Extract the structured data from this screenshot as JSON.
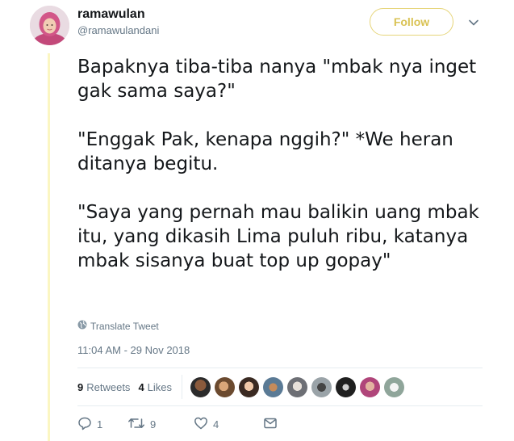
{
  "header": {
    "display_name": "ramawulan",
    "handle": "@ramawulandani",
    "follow_label": "Follow"
  },
  "tweet": {
    "paragraphs": [
      "Bapaknya tiba-tiba nanya \"mbak nya inget gak sama saya?\"",
      "\"Enggak Pak, kenapa nggih?\" *We heran ditanya begitu.",
      "\"Saya yang pernah mau balikin uang mbak itu, yang dikasih Lima puluh ribu, katanya mbak sisanya buat top up gopay\""
    ],
    "translate_label": "Translate Tweet",
    "timestamp": "11:04 AM - 29 Nov 2018"
  },
  "stats": {
    "retweets_count": "9",
    "retweets_label": "Retweets",
    "likes_count": "4",
    "likes_label": "Likes"
  },
  "actions": {
    "reply_count": "1",
    "retweet_count": "9",
    "like_count": "4"
  },
  "colors": {
    "accent": "#d9c253",
    "accent_border": "#e6d57a",
    "muted_text": "#657786",
    "thread_rule": "#fbf6c2"
  },
  "icons": {
    "translate": "globe-icon",
    "caret": "chevron-down-icon",
    "reply": "reply-icon",
    "retweet": "retweet-icon",
    "like": "heart-icon",
    "message": "envelope-icon"
  }
}
